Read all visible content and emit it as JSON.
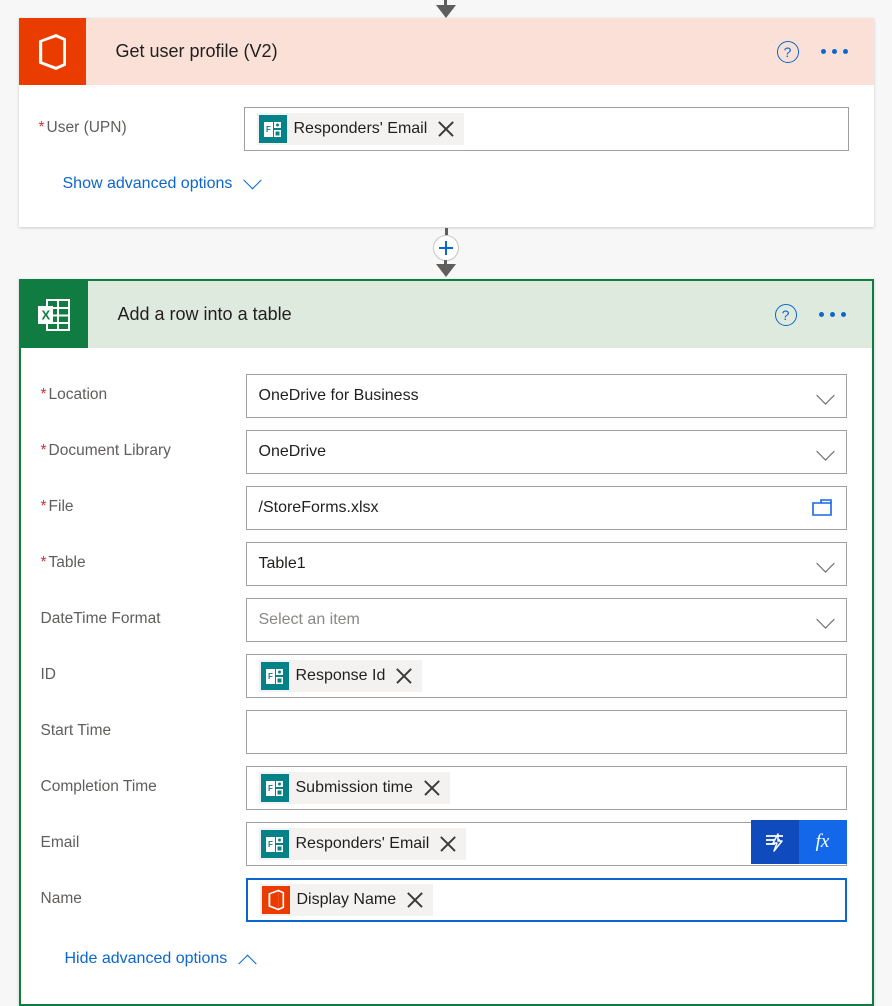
{
  "flow": {
    "connector_top": {
      "icon": "arrow-down-icon"
    },
    "connector_mid": {
      "icon": "add-step-plus-icon"
    }
  },
  "cards": [
    {
      "id": "get-user-profile",
      "title": "Get user profile (V2)",
      "app_icon": "office365-icon",
      "help_icon": "help-question-icon",
      "menu_icon": "more-options-icon",
      "selected": false,
      "fields": [
        {
          "label": "User (UPN)",
          "required": true,
          "type": "token",
          "token": {
            "text": "Responders' Email",
            "icon": "microsoft-forms-icon",
            "remove_icon": "remove-token-icon"
          }
        }
      ],
      "advanced_link": {
        "label": "Show advanced options",
        "icon": "chevron-down-icon",
        "state": "collapsed"
      }
    },
    {
      "id": "add-row-into-table",
      "title": "Add a row into a table",
      "app_icon": "excel-icon",
      "help_icon": "help-question-icon",
      "menu_icon": "more-options-icon",
      "selected": true,
      "fields": [
        {
          "label": "Location",
          "required": true,
          "type": "dropdown",
          "value": "OneDrive for Business",
          "icon": "chevron-down-icon"
        },
        {
          "label": "Document Library",
          "required": true,
          "type": "dropdown",
          "value": "OneDrive",
          "icon": "chevron-down-icon"
        },
        {
          "label": "File",
          "required": true,
          "type": "filepicker",
          "value": "/StoreForms.xlsx",
          "icon": "folder-browse-icon"
        },
        {
          "label": "Table",
          "required": true,
          "type": "dropdown",
          "value": "Table1",
          "icon": "chevron-down-icon"
        },
        {
          "label": "DateTime Format",
          "required": false,
          "type": "dropdown",
          "value": "",
          "placeholder": "Select an item",
          "icon": "chevron-down-icon"
        },
        {
          "label": "ID",
          "required": false,
          "type": "token",
          "token": {
            "text": "Response Id",
            "icon": "microsoft-forms-icon",
            "remove_icon": "remove-token-icon"
          }
        },
        {
          "label": "Start Time",
          "required": false,
          "type": "text",
          "value": ""
        },
        {
          "label": "Completion Time",
          "required": false,
          "type": "token",
          "token": {
            "text": "Submission time",
            "icon": "microsoft-forms-icon",
            "remove_icon": "remove-token-icon"
          }
        },
        {
          "label": "Email",
          "required": false,
          "type": "token",
          "token": {
            "text": "Responders' Email",
            "icon": "microsoft-forms-icon",
            "remove_icon": "remove-token-icon"
          },
          "tools": {
            "dynamic_content_icon": "dynamic-content-icon",
            "expression_label": "fx",
            "expression_icon": "expression-fx-icon"
          }
        },
        {
          "label": "Name",
          "required": false,
          "type": "token",
          "focused": true,
          "token": {
            "text": "Display Name",
            "icon": "office365-icon",
            "remove_icon": "remove-token-icon"
          }
        }
      ],
      "advanced_link": {
        "label": "Hide advanced options",
        "icon": "chevron-up-icon",
        "state": "expanded"
      }
    }
  ],
  "colors": {
    "office_accent": "#eb3c00",
    "office_header_bg": "#fbe0d8",
    "excel_accent": "#107c41",
    "excel_header_bg": "#dfeade",
    "forms_accent": "#038387",
    "link_blue": "#0b66d0",
    "required_red": "#d13438",
    "focus_blue": "#0b66d0",
    "dynamic_btn": "#0f4bbd",
    "fx_btn": "#1268e8",
    "page_bg": "#f7f7f7"
  }
}
